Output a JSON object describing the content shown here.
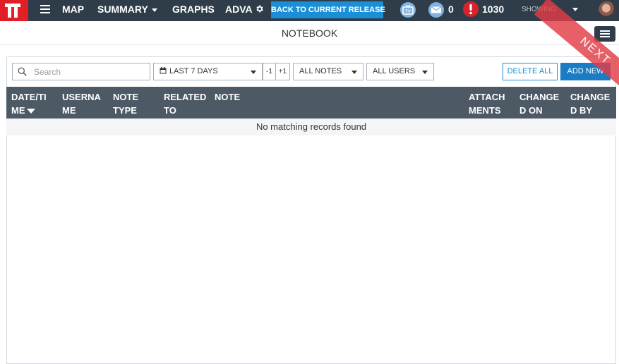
{
  "topbar": {
    "nav": {
      "map": "MAP",
      "summary": "SUMMARY",
      "graphs": "GRAPHS",
      "advanced": "ADVA"
    },
    "release_button": "BACK TO CURRENT RELEASE",
    "messages_count": "0",
    "alerts_count": "1030",
    "showing_label": "SHOWING",
    "icons": [
      "tv-icon",
      "mail-icon",
      "alert-icon",
      "gear-icon"
    ]
  },
  "page": {
    "title": "NOTEBOOK"
  },
  "toolbar": {
    "search_placeholder": "Search",
    "date_range": "LAST 7 DAYS",
    "step_back": "-1",
    "step_forward": "+1",
    "notes_filter": "ALL NOTES",
    "users_filter": "ALL USERS",
    "delete_all": "DELETE ALL",
    "add_new": "ADD NEW"
  },
  "table": {
    "columns": [
      [
        "DATE/TI",
        "ME"
      ],
      [
        "USERNA",
        "ME"
      ],
      [
        "NOTE",
        "TYPE"
      ],
      [
        "RELATED",
        "TO"
      ],
      [
        "NOTE",
        ""
      ],
      [
        "ATTACH",
        "MENTS"
      ],
      [
        "CHANGE",
        "D ON"
      ],
      [
        "CHANGE",
        "D BY"
      ]
    ],
    "empty_message": "No matching records found"
  },
  "ribbon": {
    "label": "NEXT"
  },
  "colors": {
    "topbar": "#2f3d4a",
    "brand_red": "#e21f26",
    "accent_blue": "#1a8fd6",
    "table_header": "#4d5a66"
  }
}
